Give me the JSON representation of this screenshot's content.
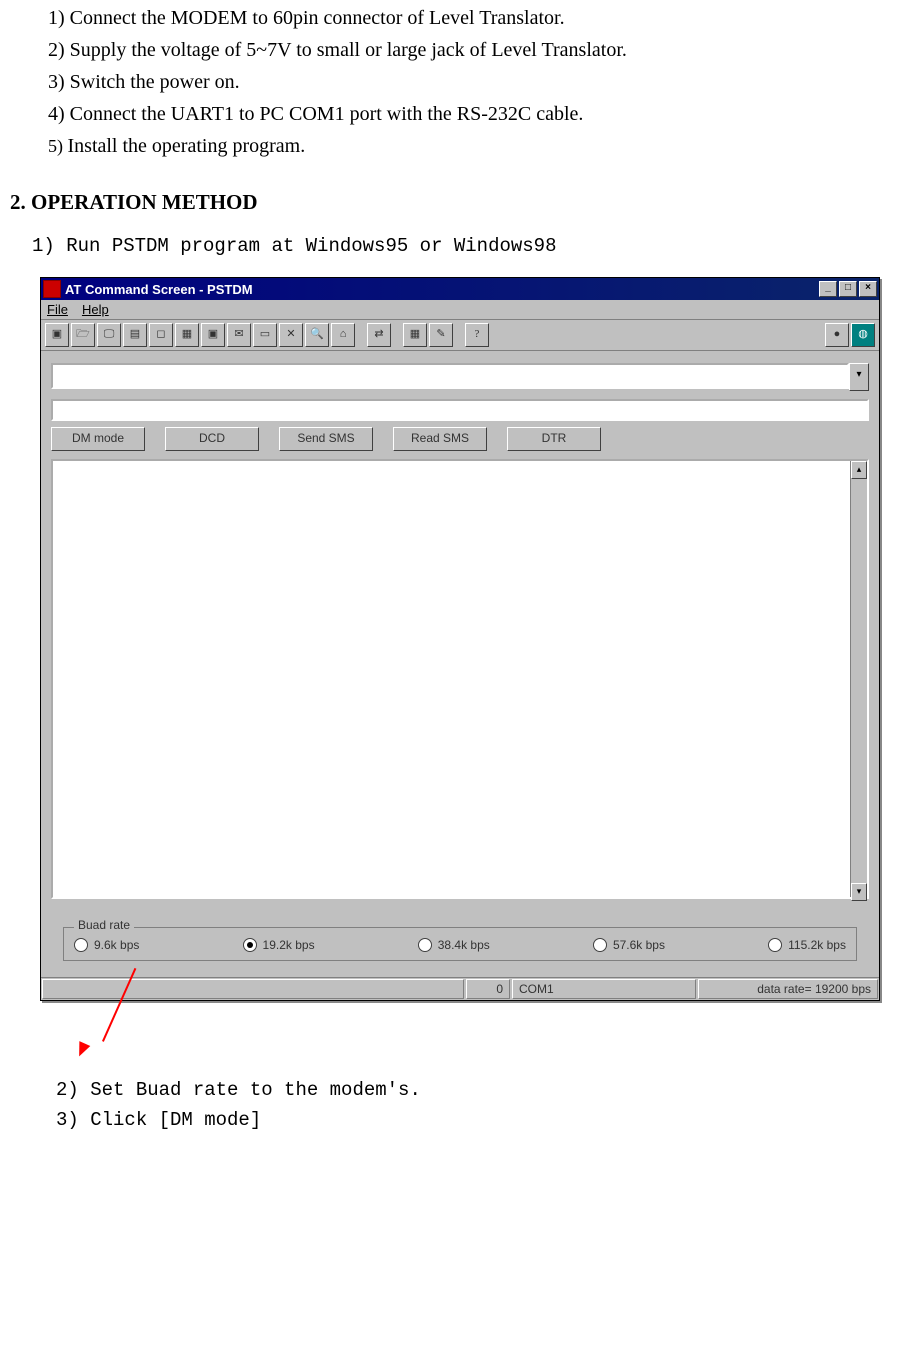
{
  "steps_top": {
    "s1": "1) Connect the MODEM to 60pin connector of Level Translator.",
    "s2": "2) Supply the voltage of 5~7V to small or large jack of Level Translator.",
    "s3": "3) Switch the power on.",
    "s4": "4) Connect the UART1 to PC COM1 port with the RS-232C cable.",
    "s5_prefix": "5) ",
    "s5_rest": "Install the operating program."
  },
  "section2_head": "2. OPERATION METHOD",
  "op1": "1) Run PSTDM program at Windows95 or Windows98",
  "window": {
    "title": "AT Command Screen - PSTDM",
    "win_min": "_",
    "win_max": "□",
    "win_close": "×",
    "menu_file": "File",
    "menu_help": "Help",
    "tb": {
      "b1": "▣",
      "b2": "🗁",
      "b3": "🖵",
      "b4": "▤",
      "b5": "◻",
      "b6": "▦",
      "b7": "▣",
      "b8": "✉",
      "b9": "▭",
      "b10": "✕",
      "b11": "🔍",
      "b12": "⌂",
      "b13": "⇄",
      "b14": "▦",
      "b15": "✎",
      "b16": "?",
      "b17": "●",
      "b18": "◍"
    },
    "btns": {
      "dm": "DM mode",
      "dcd": "DCD",
      "sendsms": "Send SMS",
      "readsms": "Read SMS",
      "dtr": "DTR"
    },
    "dropdown_arrow": "▾",
    "scroll_up": "▴",
    "scroll_down": "▾",
    "baud": {
      "legend": "Buad rate",
      "r1": "9.6k bps",
      "r2": "19.2k bps",
      "r3": "38.4k bps",
      "r4": "57.6k bps",
      "r5": "115.2k bps",
      "selected": "r2"
    },
    "status": {
      "c1": "0",
      "c2": "COM1",
      "c3": "data rate= 19200 bps"
    }
  },
  "op2": "2) Set Buad rate to the modem's.",
  "op3": "3) Click [DM mode]"
}
